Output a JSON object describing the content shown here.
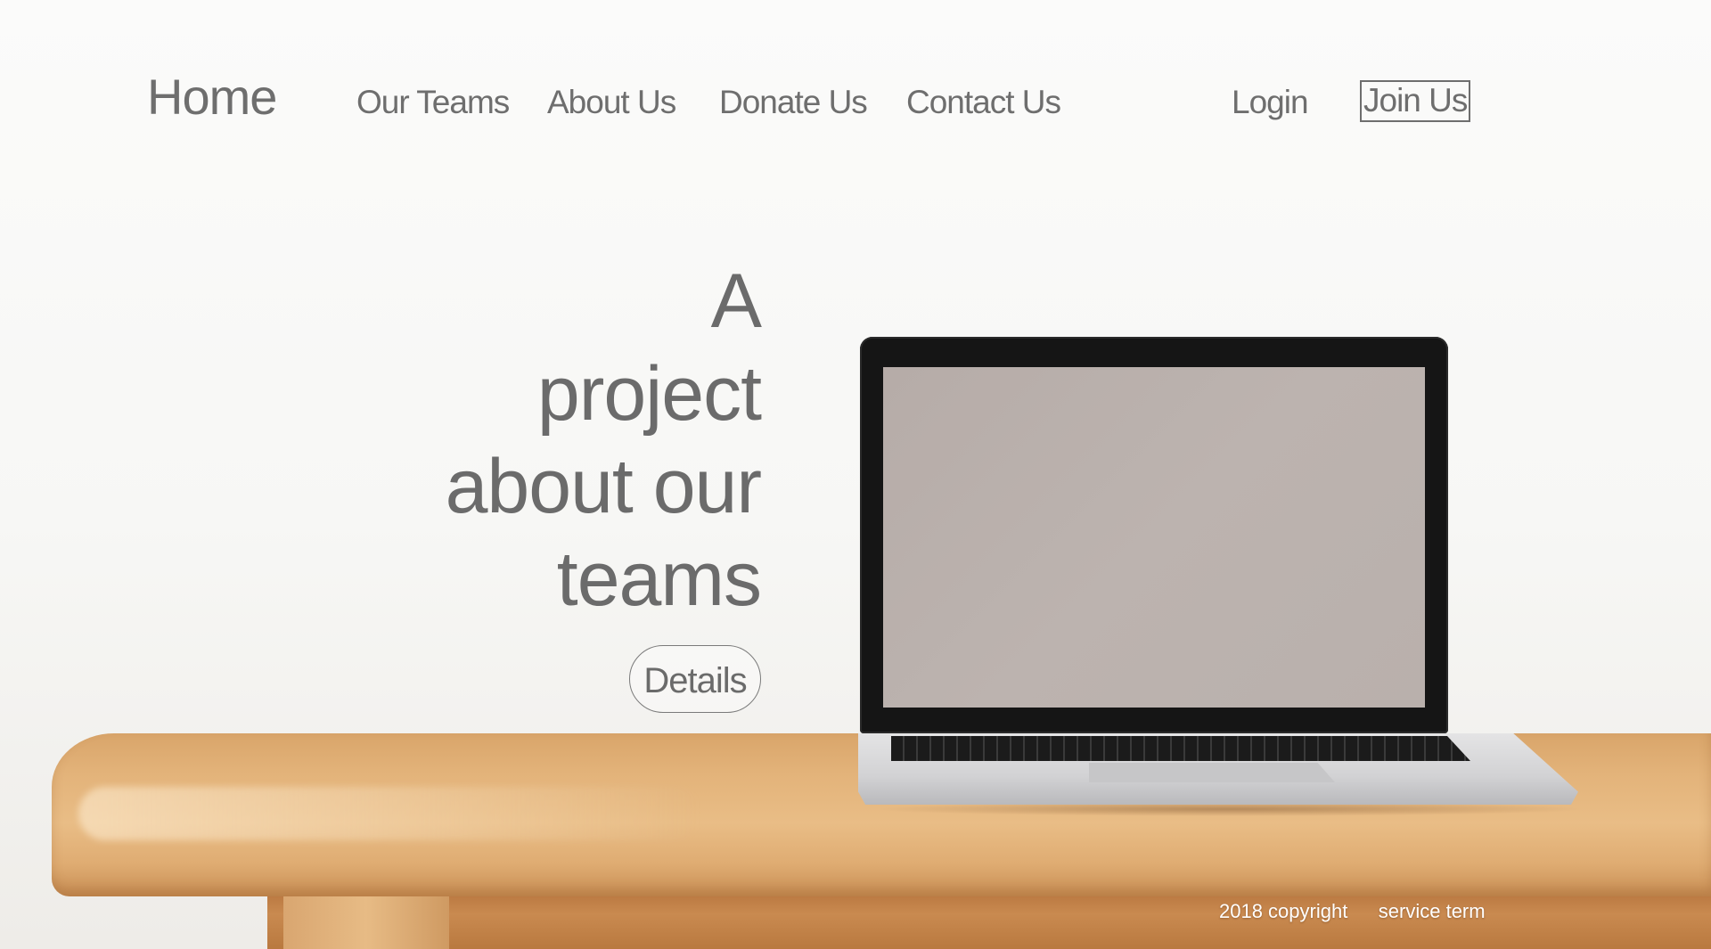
{
  "nav": {
    "home": "Home",
    "links": [
      "Our Teams",
      "About Us",
      "Donate Us",
      "Contact Us"
    ],
    "login": "Login",
    "join": "Join Us"
  },
  "hero": {
    "title_lines": [
      "A",
      "project",
      "about our",
      "teams"
    ],
    "button": "Details"
  },
  "footer": {
    "copyright": "2018 copyright",
    "terms": "service term"
  },
  "colors": {
    "text": "#6e6e6e",
    "background": "#f8f8f6",
    "desk": "#e3b37a",
    "footer_text": "#ffffff"
  }
}
